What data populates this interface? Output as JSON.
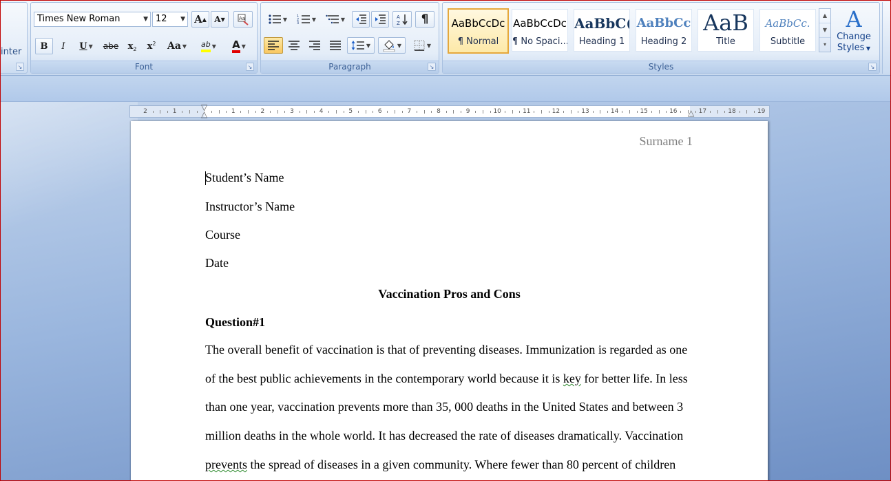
{
  "ribbon": {
    "clipboard": {
      "format_painter_label": "inter"
    },
    "font": {
      "group_label": "Font",
      "font_name": "Times New Roman",
      "font_size": "12",
      "grow_font": "A",
      "shrink_font": "A",
      "bold": "B",
      "italic": "I",
      "underline": "U",
      "strikethrough": "abe",
      "subscript": "x",
      "superscript": "x",
      "change_case": "Aa",
      "highlight": "ab",
      "font_color": "A",
      "font_color_value": "#e00000",
      "highlight_color_value": "#ffff00"
    },
    "paragraph": {
      "group_label": "Paragraph",
      "show_marks": "¶"
    },
    "styles": {
      "group_label": "Styles",
      "tiles": [
        {
          "sample": "AaBbCcDc",
          "name": "¶ Normal"
        },
        {
          "sample": "AaBbCcDc",
          "name": "¶ No Spaci..."
        },
        {
          "sample": "AaBbC(",
          "name": "Heading 1"
        },
        {
          "sample": "AaBbCc",
          "name": "Heading 2"
        },
        {
          "sample": "AaB",
          "name": "Title"
        },
        {
          "sample": "AaBbCc.",
          "name": "Subtitle"
        }
      ],
      "change_styles_line1": "Change",
      "change_styles_line2": "Styles"
    }
  },
  "ruler": {
    "labels": [
      "2",
      "1",
      "",
      "1",
      "2",
      "3",
      "4",
      "5",
      "6",
      "7",
      "8",
      "9",
      "10",
      "11",
      "12",
      "13",
      "14",
      "15",
      "16",
      "17",
      "18",
      "19"
    ]
  },
  "document": {
    "header": "Surname 1",
    "lines": {
      "student": "Student’s Name",
      "instructor": "Instructor’s Name",
      "course": "Course",
      "date": "Date",
      "title": "Vaccination Pros and Cons",
      "question": "Question#1",
      "body1": "The overall benefit of vaccination is that of preventing diseases. Immunization is regarded as one",
      "body2a": "of the best public achievements in the contemporary world because it is ",
      "body2b": "key",
      "body2c": " for better life. In less",
      "body3": "than one year, vaccination prevents more than 35, 000 deaths in the United States and between 3",
      "body4": "million deaths in the whole world. It has decreased the rate of diseases dramatically. Vaccination",
      "body5a": "prevents",
      "body5b": " the spread of diseases in a given community. Where fewer than 80 percent of children"
    }
  }
}
